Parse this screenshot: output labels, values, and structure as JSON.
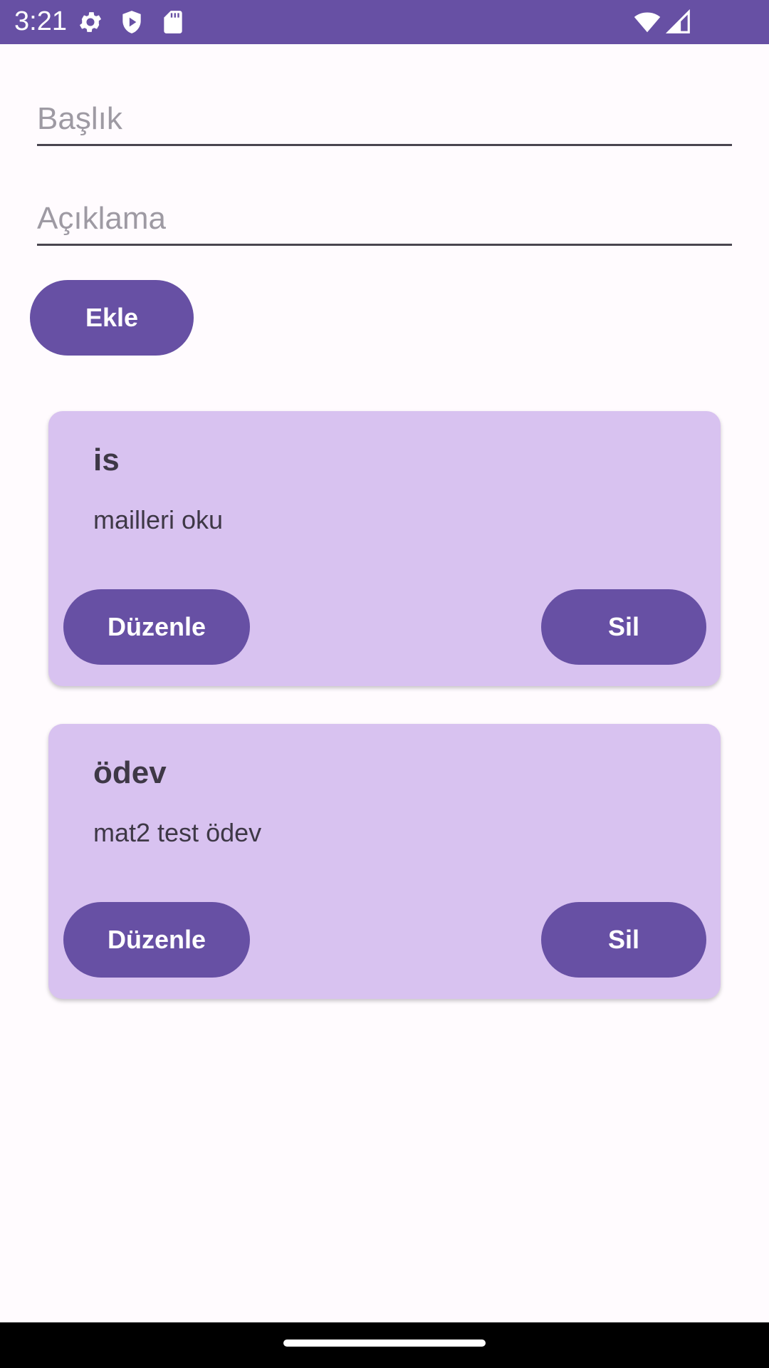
{
  "status_bar": {
    "time": "3:21",
    "icons": [
      "gear-icon",
      "shield-icon",
      "sd-card-icon",
      "wifi-icon",
      "signal-icon"
    ],
    "background": "#6750a4"
  },
  "form": {
    "title_placeholder": "Başlık",
    "title_value": "",
    "description_placeholder": "Açıklama",
    "description_value": "",
    "add_label": "Ekle"
  },
  "notes": [
    {
      "title": "is",
      "description": "mailleri oku",
      "edit_label": "Düzenle",
      "delete_label": "Sil"
    },
    {
      "title": "ödev",
      "description": "mat2 test ödev",
      "edit_label": "Düzenle",
      "delete_label": "Sil"
    }
  ],
  "colors": {
    "primary": "#6750a4",
    "card": "#d8c2f0",
    "background": "#fffbfe"
  }
}
